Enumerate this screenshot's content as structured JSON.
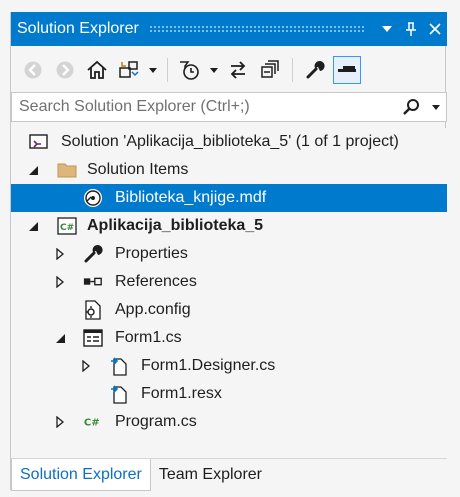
{
  "panel": {
    "title": "Solution Explorer",
    "buttons": [
      "chevron-down-icon",
      "pin-icon",
      "close-icon"
    ]
  },
  "toolbar": {
    "icons": [
      "back-icon",
      "forward-icon",
      "home-icon",
      "switch-views-icon",
      "dropdown-icon",
      "pending-changes-filter-icon",
      "dropdown-icon",
      "sync-icon",
      "collapse-all-icon",
      "properties-icon",
      "preview-selected-items-icon"
    ]
  },
  "search": {
    "placeholder": "Search Solution Explorer (Ctrl+;)"
  },
  "tree": {
    "solution": "Solution 'Aplikacija_biblioteka_5' (1 of 1 project)",
    "solution_items": "Solution Items",
    "mdf_file": "Biblioteka_knjige.mdf",
    "project": "Aplikacija_biblioteka_5",
    "properties": "Properties",
    "references": "References",
    "app_config": "App.config",
    "form1": "Form1.cs",
    "form1_designer": "Form1.Designer.cs",
    "form1_resx": "Form1.resx",
    "program": "Program.cs"
  },
  "tabs": {
    "solution_explorer": "Solution Explorer",
    "team_explorer": "Team Explorer"
  },
  "colors": {
    "accent": "#007acc",
    "selected_row": "#007acc",
    "csharp_green": "#388a34"
  }
}
